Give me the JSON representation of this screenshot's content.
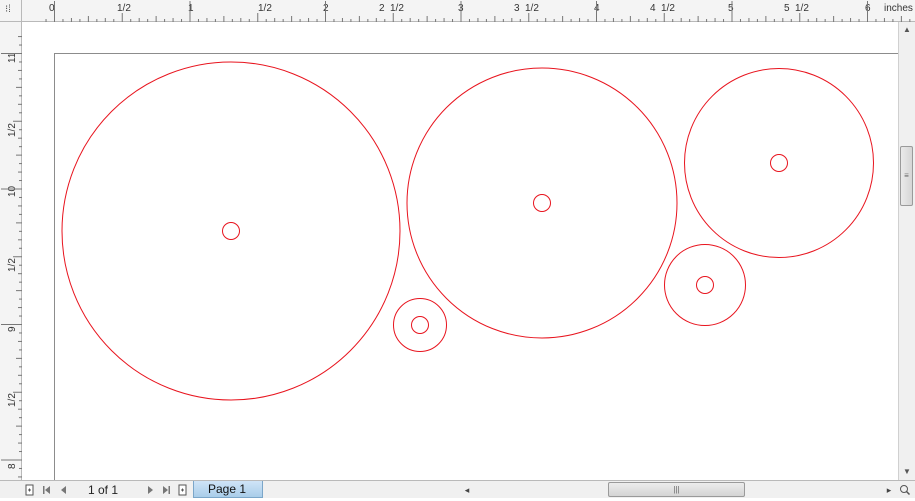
{
  "ruler": {
    "units_label": "inches",
    "corner_icon": "ruler-origin-icon",
    "horizontal_ticks": [
      "0",
      "1/2",
      "1",
      "1/2",
      "2",
      "2",
      "1/2",
      "3",
      "3",
      "1/2",
      "4",
      "4",
      "1/2",
      "5",
      "5",
      "1/2",
      "6"
    ],
    "vertical_ticks": [
      "11",
      "1/2",
      "10",
      "1/2",
      "9",
      "1/2",
      "8"
    ]
  },
  "drawing": {
    "stroke_color": "#e8141e",
    "circles_count": 10
  },
  "status": {
    "page_count": "1 of 1",
    "page_tab": "Page 1",
    "icons": [
      "add-page-before-icon",
      "first-page-icon",
      "prev-page-icon",
      "next-page-icon",
      "last-page-icon",
      "add-page-after-icon",
      "zoom-icon"
    ]
  }
}
